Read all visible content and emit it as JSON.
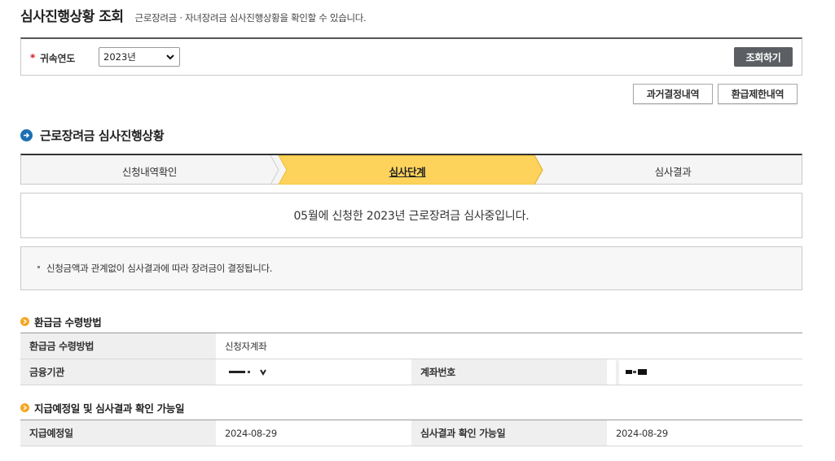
{
  "header": {
    "title": "심사진행상황 조회",
    "description": "근로장려금 · 자녀장려금 심사진행상황을 확인할 수 있습니다."
  },
  "search": {
    "required_mark": "*",
    "year_label": "귀속연도",
    "year_value": "2023년",
    "search_button": "조회하기"
  },
  "actions": {
    "past_decisions": "과거결정내역",
    "refund_limits": "환급제한내역"
  },
  "section": {
    "title": "근로장려금 심사진행상황",
    "steps": [
      {
        "label": "신청내역확인",
        "active": false
      },
      {
        "label": "심사단계",
        "active": true
      },
      {
        "label": "심사결과",
        "active": false
      }
    ],
    "status_message": "05월에 신청한 2023년 근로장려금 심사중입니다.",
    "note": "신청금액과 관계없이 심사결과에 따라 장려금이 결정됩니다."
  },
  "refund_method": {
    "title": "환급금 수령방법",
    "rows": {
      "method_label": "환급금 수령방법",
      "method_value": "신청자계좌",
      "bank_label": "금융기관",
      "account_label": "계좌번호"
    }
  },
  "payment_schedule": {
    "title": "지급예정일 및 심사결과 확인 가능일",
    "rows": {
      "payment_date_label": "지급예정일",
      "payment_date_value": "2024-08-29",
      "result_date_label": "심사결과 확인 가능일",
      "result_date_value": "2024-08-29"
    }
  },
  "colors": {
    "active_step": "#fdd35c",
    "search_button": "#5b5f63",
    "section_icon": "#1d6fb4",
    "sub_icon": "#f5a623",
    "required_mark": "#d6181e"
  }
}
